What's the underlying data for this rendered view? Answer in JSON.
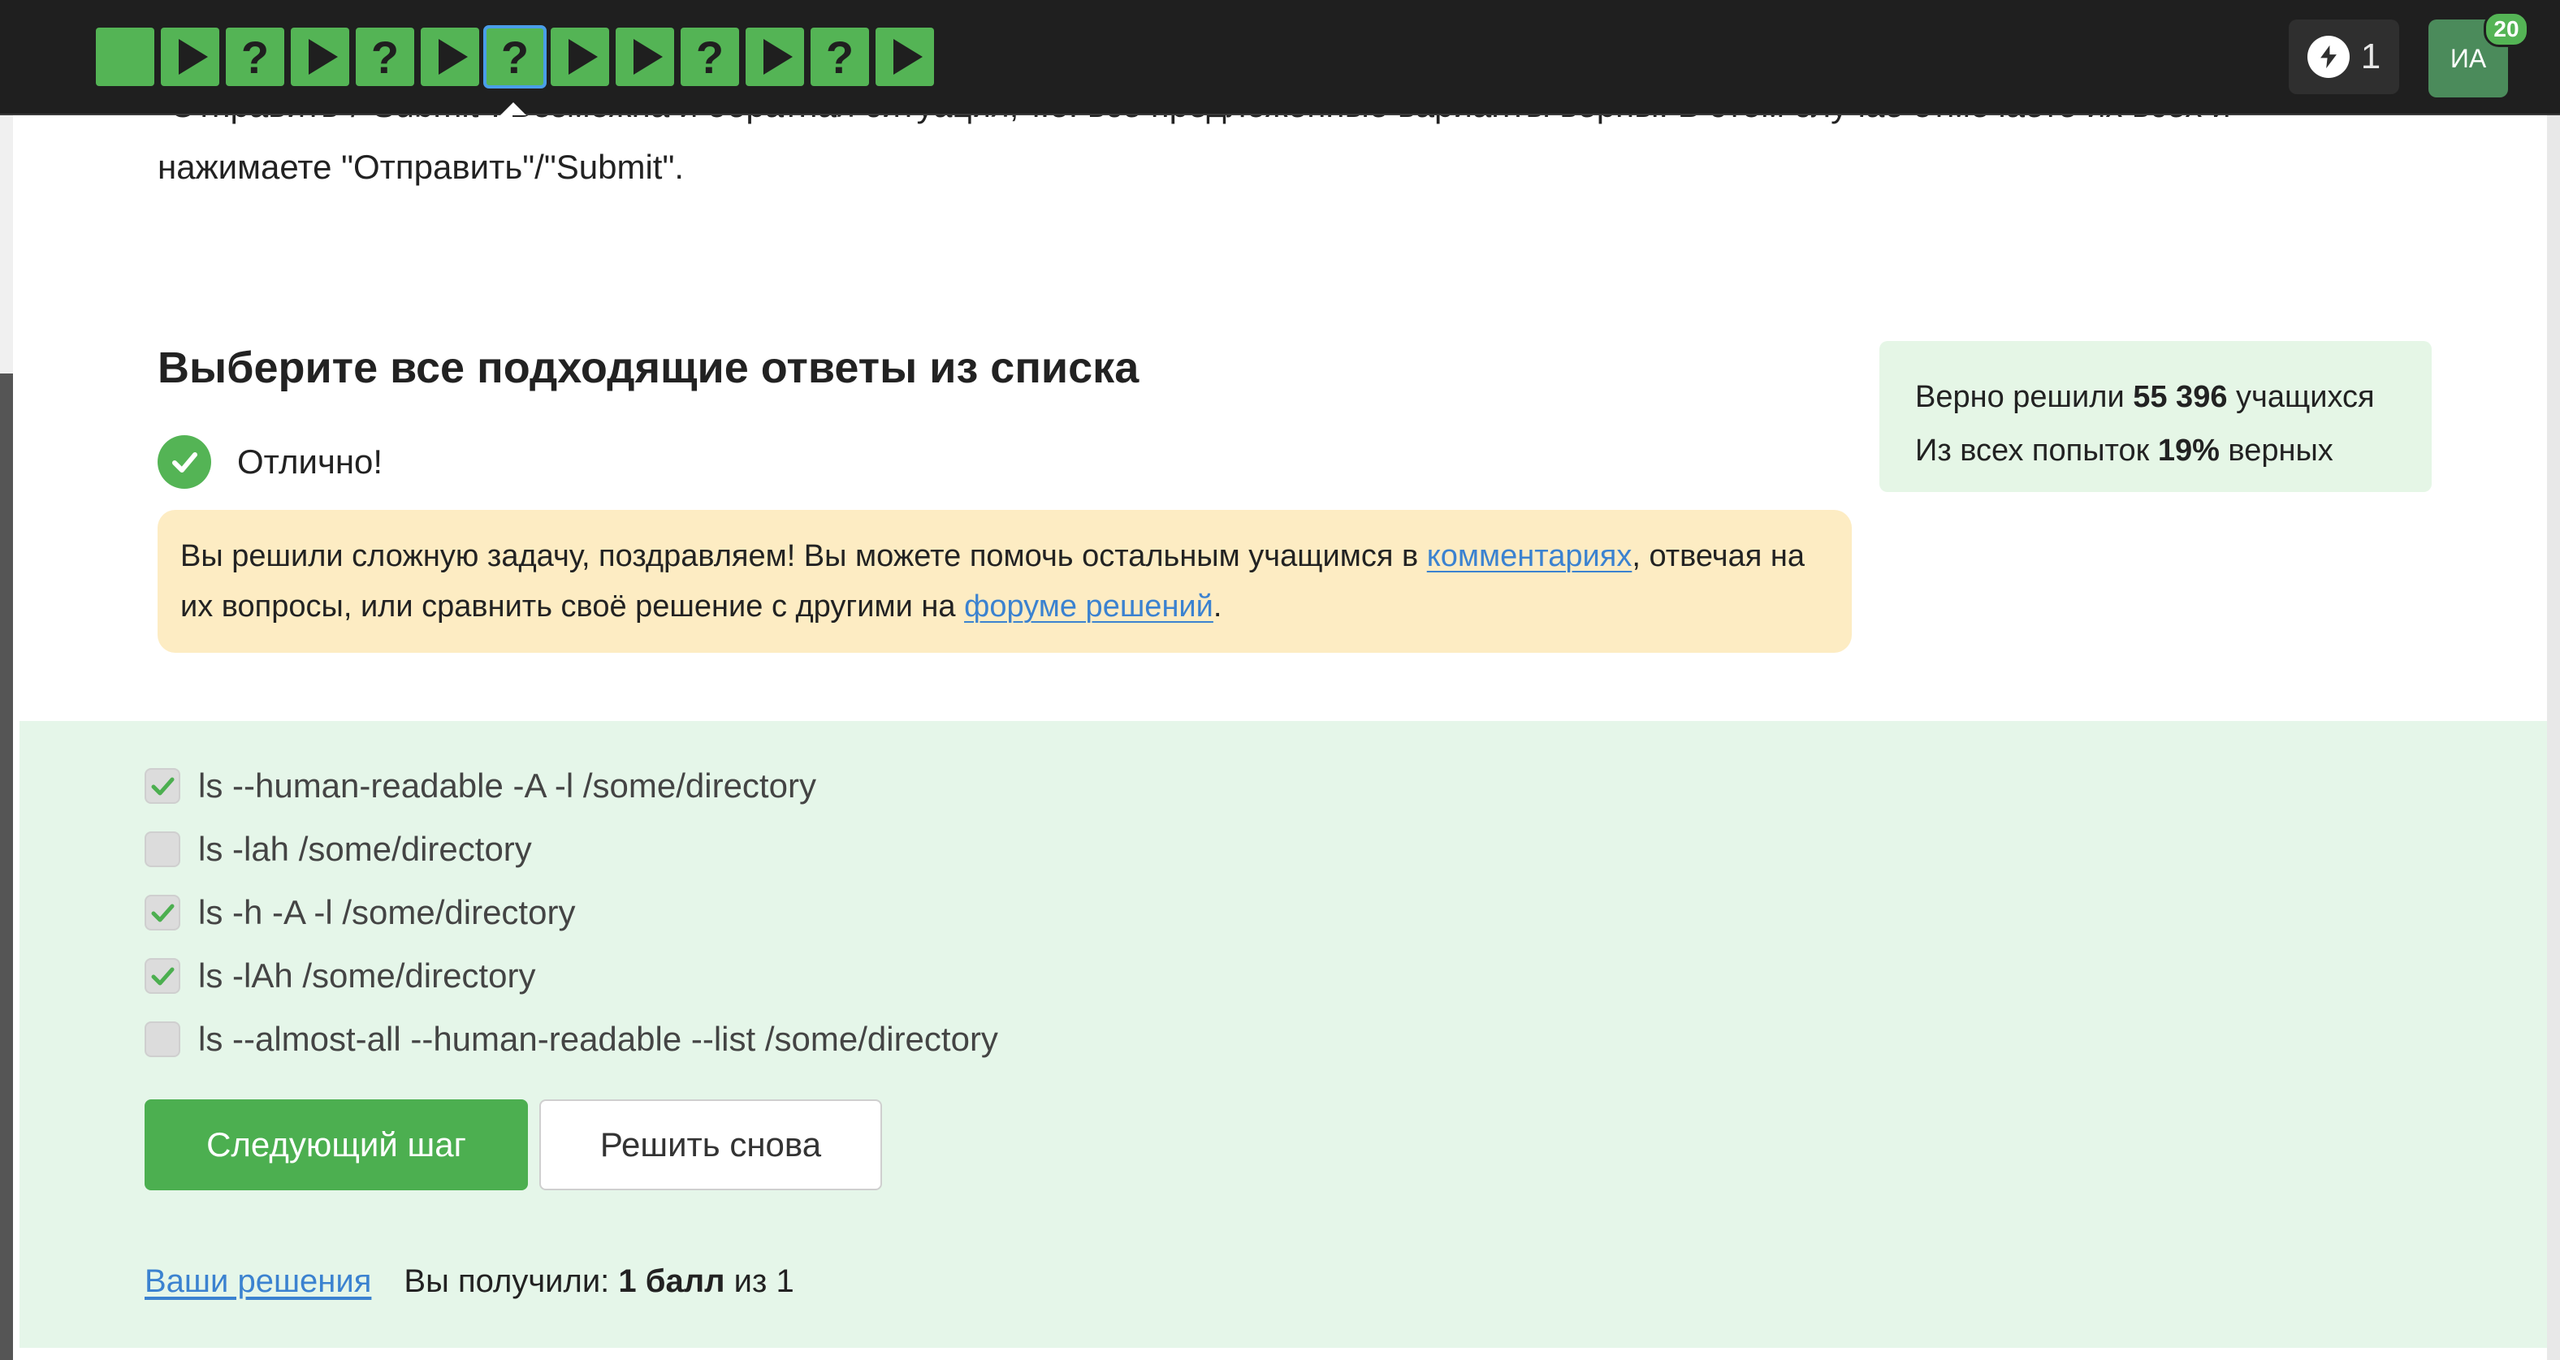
{
  "topbar": {
    "steps": [
      {
        "kind": "blank"
      },
      {
        "kind": "play"
      },
      {
        "kind": "quiz",
        "label": "?"
      },
      {
        "kind": "play"
      },
      {
        "kind": "quiz",
        "label": "?"
      },
      {
        "kind": "play"
      },
      {
        "kind": "quiz",
        "label": "?",
        "active": true
      },
      {
        "kind": "play"
      },
      {
        "kind": "play"
      },
      {
        "kind": "quiz",
        "label": "?"
      },
      {
        "kind": "play"
      },
      {
        "kind": "quiz",
        "label": "?"
      },
      {
        "kind": "play"
      }
    ],
    "energy_count": "1",
    "avatar_initials": "ИА",
    "notification_count": "20"
  },
  "intro": {
    "clipped_line": "\"Отправить\"/\"Submit\". Возможна и обратная ситуация, т.е. все предложенные варианты верны. В этом случае отмечаете их всех и",
    "line": "нажимаете \"Отправить\"/\"Submit\"."
  },
  "question": {
    "title": "Выберите все подходящие ответы из списка",
    "feedback": "Отлично!"
  },
  "hint": {
    "part1": "Вы решили сложную задачу, поздравляем! Вы можете помочь остальным учащимся в ",
    "link1": "комментариях",
    "part2": ", отвечая на их вопросы, или сравнить своё решение с другими на ",
    "link2": "форуме решений",
    "part3": "."
  },
  "stats": {
    "solved_prefix": "Верно решили ",
    "solved_count": "55 396",
    "solved_suffix": " учащихся",
    "attempts_prefix": "Из всех попыток ",
    "attempts_percent": "19%",
    "attempts_suffix": " верных"
  },
  "options": [
    {
      "text": "ls --human-readable -A  -l /some/directory",
      "checked": true
    },
    {
      "text": "ls -lah /some/directory",
      "checked": false
    },
    {
      "text": "ls -h -A -l /some/directory",
      "checked": true
    },
    {
      "text": "ls -lAh /some/directory",
      "checked": true
    },
    {
      "text": "ls --almost-all --human-readable --list /some/directory",
      "checked": false
    }
  ],
  "buttons": {
    "next": "Следующий шаг",
    "retry": "Решить снова"
  },
  "footer": {
    "solutions_link": "Ваши решения",
    "score_prefix": "Вы получили: ",
    "score_value": "1 балл",
    "score_suffix": " из 1"
  },
  "colors": {
    "accent_green": "#4caf50",
    "link_blue": "#3b82d0",
    "hint_bg": "#fdecc3",
    "answers_bg": "#e5f6e9"
  }
}
